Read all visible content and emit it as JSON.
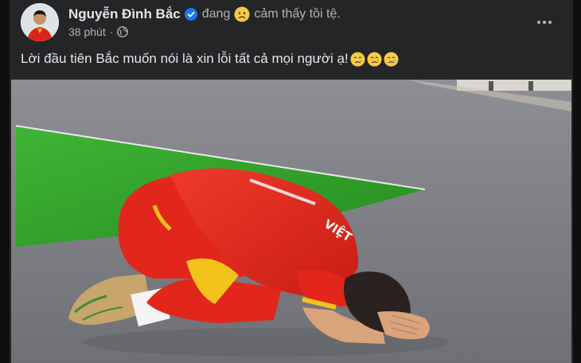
{
  "post": {
    "author": "Nguyễn Đình Bắc",
    "verified": true,
    "status_verb": "đang",
    "status_emoji": "slightly-frowning-face",
    "status_feeling": "cảm thấy tồi tệ.",
    "time": "38 phút",
    "separator": "·",
    "audience_icon": "globe-icon",
    "text": "Lời đầu tiên Bắc muốn nói là xin lỗi tất cả mọi người ạ!",
    "text_emojis": [
      "crying-face",
      "crying-face",
      "crying-face"
    ]
  },
  "photo": {
    "description_icon": "player-kneeling-photo",
    "jersey_text": "VIỆT"
  },
  "colors": {
    "background": "#242526",
    "text_primary": "#e4e6eb",
    "text_secondary": "#b0b3b8",
    "verified_blue": "#1877f2",
    "jersey_red": "#e3261c",
    "jersey_yellow": "#f2c31b",
    "pitch_green": "#2fa12a"
  }
}
